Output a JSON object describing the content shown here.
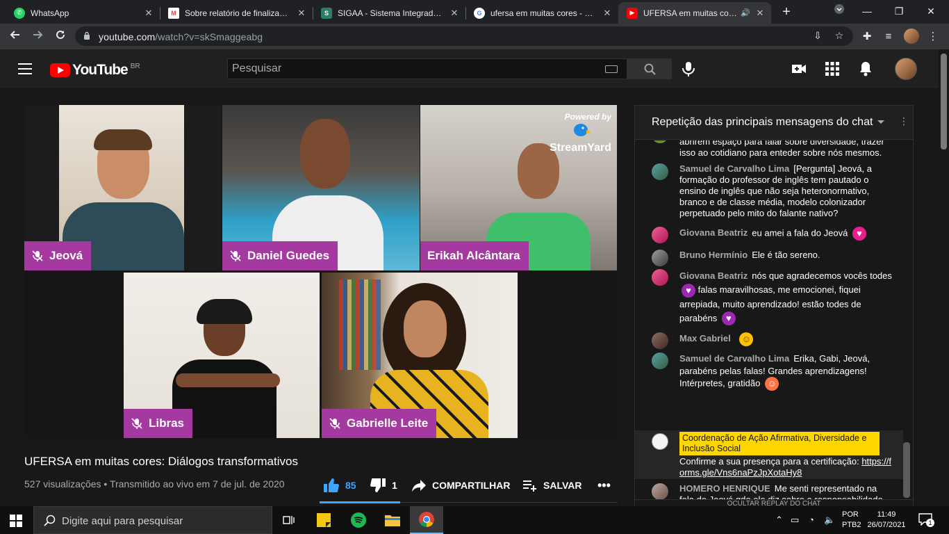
{
  "browser": {
    "tabs": [
      {
        "title": "WhatsApp",
        "favicon": "whatsapp-icon",
        "color": "#25d366"
      },
      {
        "title": "Sobre relatório de finalização",
        "favicon": "gmail-icon",
        "color": "#ea4335"
      },
      {
        "title": "SIGAA - Sistema Integrado de",
        "favicon": "sigaa-icon",
        "color": "#2e7d6b"
      },
      {
        "title": "ufersa em muitas cores - Pesq",
        "favicon": "google-icon",
        "color": "#4285f4"
      },
      {
        "title": "UFERSA em muitas cores",
        "favicon": "youtube-icon",
        "color": "#ff0000"
      }
    ],
    "active_tab": 4,
    "url_host": "youtube.com",
    "url_path": "/watch?v=skSmaggeabg"
  },
  "youtube": {
    "logo_text": "YouTube",
    "country_code": "BR",
    "search_placeholder": "Pesquisar"
  },
  "video": {
    "title": "UFERSA em muitas cores: Diálogos transformativos",
    "meta": "527 visualizações • Transmitido ao vivo em 7 de jul. de 2020",
    "likes": "85",
    "dislikes": "1",
    "share_label": "COMPARTILHAR",
    "save_label": "SALVAR",
    "watermark_powered": "Powered by",
    "watermark_brand": "StreamYard",
    "participants": [
      "Jeová",
      "Daniel Guedes",
      "Erikah Alcântara",
      "Libras",
      "Gabrielle Leite"
    ]
  },
  "chat": {
    "title": "Repetição das principais mensagens do chat",
    "messages": [
      {
        "author": "",
        "text": "abrirem espaço para falar sobre diversidade, trazer isso ao cotidiano para enteder sobre nós mesmos."
      },
      {
        "author": "Samuel de Carvalho Lima",
        "text": "[Pergunta] Jeová, a formação do professor de inglês tem pautado o ensino de inglês que não seja heteronormativo, branco e de classe média, modelo colonizador perpetuado pelo mito do falante nativo?"
      },
      {
        "author": "Giovana Beatriz",
        "text": "eu amei a fala do Jeová"
      },
      {
        "author": "Bruno Hermínio",
        "text": "Ele é tão sereno."
      },
      {
        "author": "Giovana Beatriz",
        "text_a": "nós que agradecemos vocês todes",
        "text_b": "falas maravilhosas, me emocionei, fiquei arrepiada, muito aprendizado! estão todes de parabéns"
      },
      {
        "author": "Max Gabriel",
        "text": ""
      },
      {
        "author": "Samuel de Carvalho Lima",
        "text": "Erika, Gabi, Jeová, parabéns pelas falas! Grandes aprendizagens! Intérpretes, gratidão"
      },
      {
        "author": "Coordenação de Ação Afirmativa, Diversidade e Inclusão Social",
        "text": "Confirme a sua presença para a certificação:",
        "link": "https://forms.gle/Vns6naPzJpXotaHy8"
      },
      {
        "author": "HOMERO HENRIQUE",
        "text": "Me senti representado na fala de Jeová qdo ele diz sobre a responsabilidade do papel do professor e da necessidade de não nos \"neutralizarmos\""
      }
    ],
    "footer": "OCULTAR REPLAY DO CHAT"
  },
  "taskbar": {
    "search_placeholder": "Digite aqui para pesquisar",
    "lang_1": "POR",
    "lang_2": "PTB2",
    "time": "11:49",
    "date": "26/07/2021",
    "notifications": "1"
  }
}
